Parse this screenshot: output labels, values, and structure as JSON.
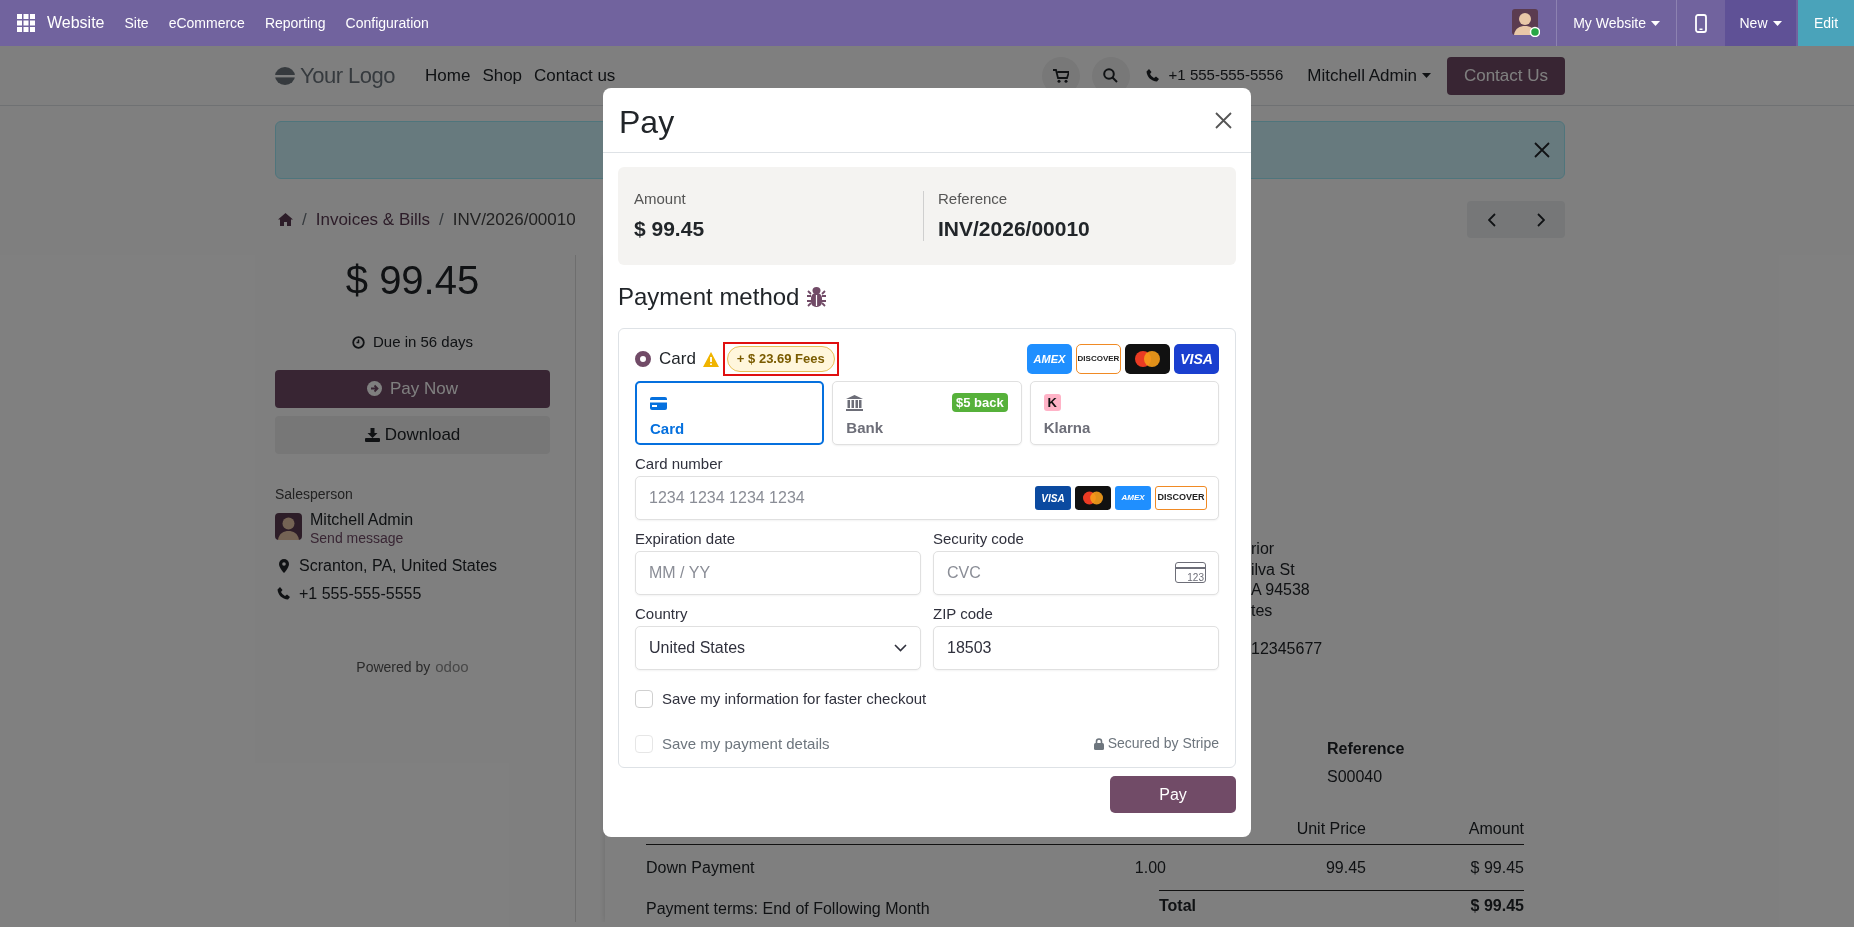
{
  "top_bar": {
    "app_name": "Website",
    "menu": [
      "Site",
      "eCommerce",
      "Reporting",
      "Configuration"
    ],
    "website_switcher": "My Website",
    "new_button": "New",
    "edit_button": "Edit"
  },
  "site_header": {
    "logo": "Your Logo",
    "nav": [
      "Home",
      "Shop",
      "Contact us"
    ],
    "phone": "+1 555-555-5556",
    "user": "Mitchell Admin",
    "cta": "Contact Us"
  },
  "breadcrumb": {
    "separator": "/",
    "items": [
      "Invoices & Bills",
      "INV/2026/00010"
    ]
  },
  "sidebar": {
    "amount": "$ 99.45",
    "due": "Due in 56 days",
    "pay_now": "Pay Now",
    "download": "Download",
    "salesperson_label": "Salesperson",
    "salesperson": "Mitchell Admin",
    "send_message": "Send message",
    "address": "Scranton, PA, United States",
    "phone": "+1 555-555-5555",
    "powered_by": "Powered by",
    "powered_brand": "odoo"
  },
  "document": {
    "address_lines": [
      "rior",
      "ilva St",
      "A 94538",
      "tes"
    ],
    "tax_id": "12345677",
    "reference_label": "Reference",
    "reference": "S00040",
    "columns": [
      "Unit Price",
      "Amount"
    ],
    "rows": [
      {
        "description": "Down Payment",
        "quantity": "1.00",
        "unit_price": "99.45",
        "amount": "$ 99.45"
      }
    ],
    "total_label": "Total",
    "total": "$ 99.45",
    "payment_terms": "Payment terms: End of Following Month"
  },
  "dialog": {
    "title": "Pay",
    "amount_label": "Amount",
    "amount": "$ 99.45",
    "reference_label": "Reference",
    "reference": "INV/2026/00010",
    "section_title": "Payment method",
    "provider": {
      "label": "Card",
      "selected": true,
      "fee": "+ $ 23.69 Fees",
      "brands": [
        {
          "kind": "amex",
          "text": "AMEX"
        },
        {
          "kind": "discover",
          "text": "DISCOVER"
        },
        {
          "kind": "mastercard"
        },
        {
          "kind": "visa",
          "text": "VISA"
        }
      ]
    },
    "tabs": [
      {
        "kind": "card",
        "label": "Card",
        "selected": true
      },
      {
        "kind": "bank",
        "label": "Bank",
        "selected": false,
        "badge": "$5 back"
      },
      {
        "kind": "klarna",
        "label": "Klarna",
        "selected": false,
        "logo": "K"
      }
    ],
    "fields": [
      {
        "kind": "card_number",
        "label": "Card number",
        "placeholder": "1234 1234 1234 1234",
        "brands": [
          {
            "kind": "visa",
            "text": "VISA"
          },
          {
            "kind": "mastercard"
          },
          {
            "kind": "amex",
            "text": "AMEX"
          },
          {
            "kind": "discover",
            "text": "DISCOVER"
          }
        ]
      },
      {
        "kind": "expiry",
        "label": "Expiration date",
        "placeholder": "MM / YY"
      },
      {
        "kind": "cvc",
        "label": "Security code",
        "placeholder": "CVC",
        "icon_text": "123"
      },
      {
        "kind": "select",
        "label": "Country",
        "value": "United States"
      },
      {
        "kind": "text",
        "label": "ZIP code",
        "value": "18503"
      }
    ],
    "checkboxes": [
      {
        "label": "Save my information for faster checkout",
        "checked": false,
        "disabled": false
      },
      {
        "label": "Save my payment details",
        "checked": false,
        "disabled": true
      }
    ],
    "secured_note": "Secured by Stripe",
    "pay_button": "Pay"
  }
}
